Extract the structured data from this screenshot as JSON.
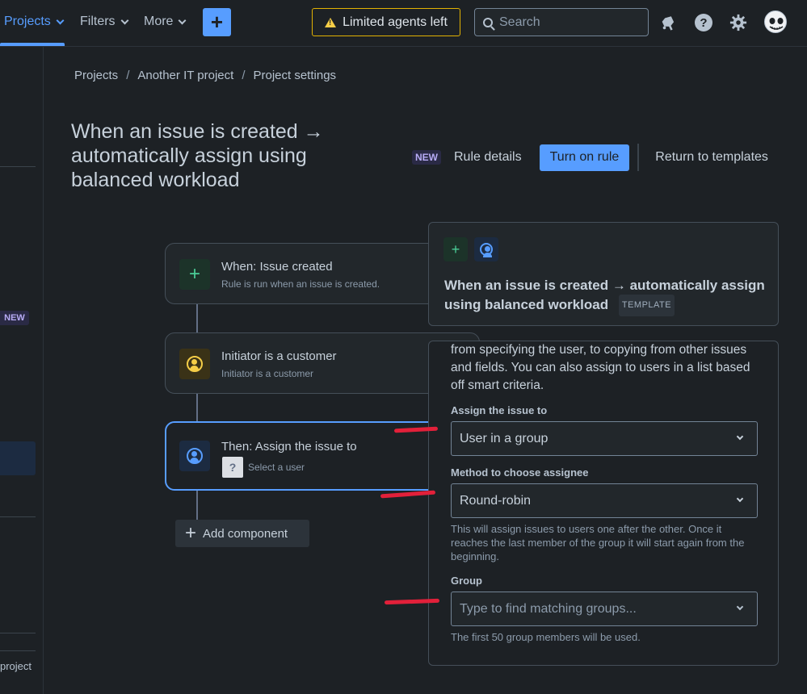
{
  "nav": {
    "projects": "Projects",
    "filters": "Filters",
    "more": "More",
    "create": "+",
    "limited_agents": "Limited agents left",
    "search_placeholder": "Search"
  },
  "sidebar": {
    "new_badge": "NEW",
    "project_text": "project"
  },
  "breadcrumb": {
    "items": [
      "Projects",
      "Another IT project",
      "Project settings"
    ],
    "separator": "/"
  },
  "page": {
    "title": "When an issue is created → automatically assign using balanced workload",
    "new_badge": "NEW",
    "rule_details": "Rule details",
    "turn_on_rule": "Turn on rule",
    "return_to_templates": "Return to templates"
  },
  "flow": {
    "trigger": {
      "title": "When: Issue created",
      "subtitle": "Rule is run when an issue is created."
    },
    "condition": {
      "title": "Initiator is a customer",
      "subtitle": "Initiator is a customer"
    },
    "action": {
      "title": "Then: Assign the issue to",
      "subtitle": "Select a user",
      "avatar_glyph": "?"
    },
    "add_component": "Add component"
  },
  "template_panel": {
    "title": "When an issue is created → automatically assign using balanced workload",
    "badge": "TEMPLATE"
  },
  "config_panel": {
    "description": "from specifying the user, to copying from other issues and fields. You can also assign to users in a list based off smart criteria.",
    "assign_label": "Assign the issue to",
    "assign_value": "User in a group",
    "method_label": "Method to choose assignee",
    "method_value": "Round-robin",
    "method_help": "This will assign issues to users one after the other. Once it reaches the last member of the group it will start again from the beginning.",
    "group_label": "Group",
    "group_placeholder": "Type to find matching groups...",
    "group_help": "The first 50 group members will be used."
  },
  "colors": {
    "accent": "#579dff",
    "warning": "#e2b203",
    "trigger_green": "#4bce97",
    "condition_yellow": "#f5cd47",
    "annotation_red": "#e2203a"
  }
}
